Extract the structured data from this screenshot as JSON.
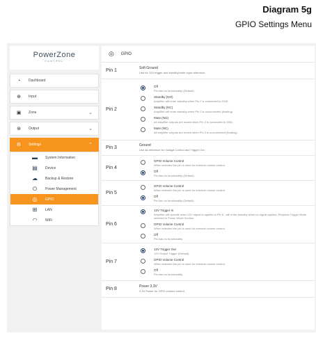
{
  "caption": {
    "title": "Diagram 5g",
    "subtitle": "GPIO Settings Menu"
  },
  "brand": {
    "logo": "PowerZone",
    "sub": "CONTROL"
  },
  "sidebar": {
    "items": [
      {
        "label": "Dashboard",
        "icon": "dashboard-icon"
      },
      {
        "label": "Input",
        "icon": "input-icon"
      },
      {
        "label": "Zone",
        "icon": "zone-icon"
      },
      {
        "label": "Output",
        "icon": "output-icon"
      },
      {
        "label": "Settings",
        "icon": "settings-icon"
      }
    ],
    "sub_items": [
      {
        "label": "System Information",
        "icon": "system-info-icon"
      },
      {
        "label": "Device",
        "icon": "device-icon"
      },
      {
        "label": "Backup & Restore",
        "icon": "cloud-upload-icon"
      },
      {
        "label": "Power Management",
        "icon": "power-icon"
      },
      {
        "label": "GPIO",
        "icon": "gpio-icon"
      },
      {
        "label": "LAN",
        "icon": "lan-icon"
      },
      {
        "label": "WiFi",
        "icon": "wifi-icon"
      }
    ]
  },
  "main": {
    "title": "GPIO",
    "pins": [
      {
        "label": "Pin 1",
        "static_title": "Soft Ground",
        "static_desc": "Use for 12V trigger and standby/mute input reference."
      },
      {
        "label": "Pin 2",
        "options": [
          {
            "title": "Off",
            "desc": "Pin has no functionality (Default).",
            "selected": true
          },
          {
            "title": "Standby (NO)",
            "desc": "Amplifier will enter standby when Pin 2 is connected to GND."
          },
          {
            "title": "Standby (NC)",
            "desc": "Amplifier will enter standby when Pin 2 is unconnected (floating)."
          },
          {
            "title": "Mute (NO)",
            "desc": "All amplifier outputs are muted when Pin 2 is connected to GND."
          },
          {
            "title": "Mute (NC)",
            "desc": "All amplifier outputs are muted when Pin 2 is unconnected (floating)."
          }
        ]
      },
      {
        "label": "Pin 3",
        "static_title": "Ground",
        "static_desc": "Use as reference for Voltage Control and Trigger Out."
      },
      {
        "label": "Pin 4",
        "options": [
          {
            "title": "GPIO Volume Control",
            "desc": "When selected the pin is used for external volume control."
          },
          {
            "title": "Off",
            "desc": "Pin has no functionality (Default).",
            "selected": true
          }
        ]
      },
      {
        "label": "Pin 5",
        "options": [
          {
            "title": "GPIO Volume Control",
            "desc": "When selected the pin is used for external volume control."
          },
          {
            "title": "Off",
            "desc": "Pin has no functionality (Default).",
            "selected": true
          }
        ]
      },
      {
        "label": "Pin 6",
        "options": [
          {
            "title": "12V Trigger In",
            "desc": "Amplifier will operate when 12V signal is applied to Pin 6 - will enter standby when no signal applied. Requires Trigger Mode selected in Power Mode Section.",
            "selected": true
          },
          {
            "title": "GPIO Volume Control",
            "desc": "When selected the pin is used for external volume control."
          },
          {
            "title": "Off",
            "desc": "Pin has no functionality."
          }
        ]
      },
      {
        "label": "Pin 7",
        "options": [
          {
            "title": "12V Trigger Out",
            "desc": "12V Output Trigger (Default).",
            "selected": true
          },
          {
            "title": "GPIO Volume Control",
            "desc": "When selected the pin is used for external volume control."
          },
          {
            "title": "Off",
            "desc": "Pin has no functionality."
          }
        ]
      },
      {
        "label": "Pin 8",
        "static_title": "Power 3.3V",
        "static_desc": "3.3V Power for GPIO volume control."
      }
    ]
  }
}
